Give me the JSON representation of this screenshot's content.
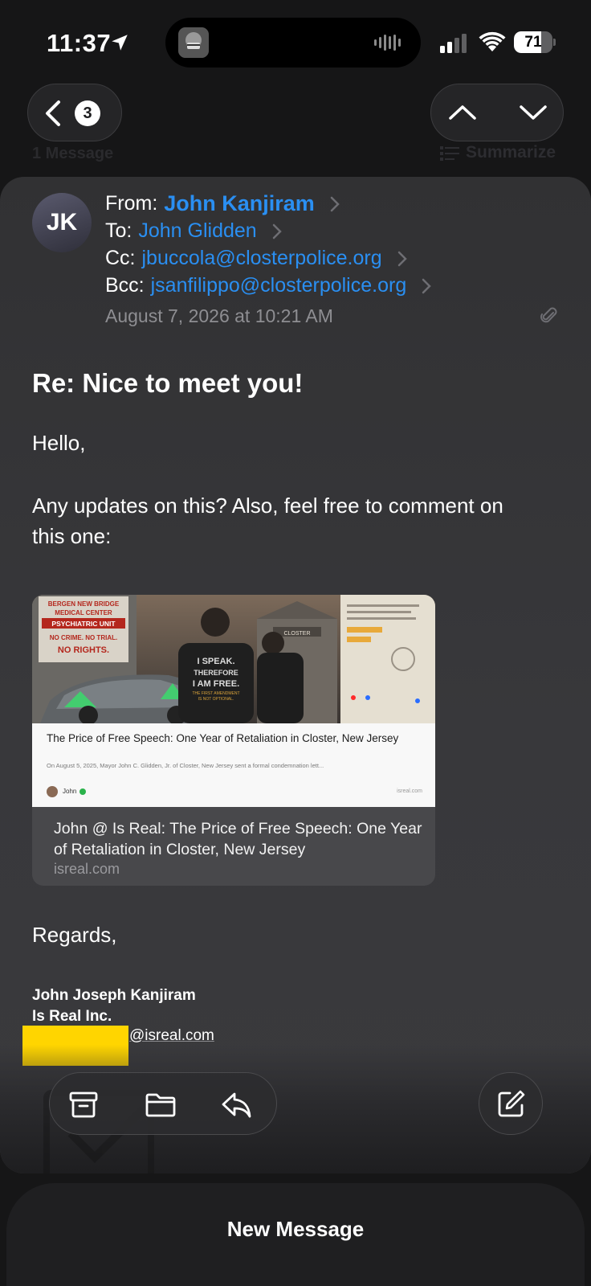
{
  "status_bar": {
    "time": "11:37",
    "battery_percent": "71",
    "battery_level": 0.71,
    "icons": [
      "location-arrow-icon",
      "signal-icon",
      "wifi-icon",
      "battery-icon"
    ]
  },
  "nav": {
    "back_count": "3",
    "messages_count": "1 Message",
    "summarize_label": "Summarize"
  },
  "email": {
    "avatar_initials": "JK",
    "from_label": "From:",
    "from": "John Kanjiram",
    "to_label": "To:",
    "to": "John Glidden",
    "cc_label": "Cc:",
    "cc": "jbuccola@closterpolice.org",
    "bcc_label": "Bcc:",
    "bcc": "jsanfilippo@closterpolice.org",
    "date": "August 7, 2026 at 10:21 AM",
    "subject": "Re: Nice to meet you!",
    "greeting": "Hello,",
    "body_line1": "Any updates on this? Also, feel free to comment on",
    "body_line2": "this one:",
    "closing": "Regards,",
    "signature_name": "John Joseph Kanjiram",
    "signature_company": "Is Real Inc.",
    "signature_email": "@isreal.com"
  },
  "link_preview": {
    "article_title": "The Price of Free Speech: One Year of Retaliation in Closter,  New Jersey",
    "article_desc": "On August 5, 2025, Mayor John C. Glidden, Jr. of Closter, New Jersey sent a formal condemnation lett...",
    "article_author": "John",
    "article_domain": "isreal.com",
    "caption": "John @ Is Real: The Price of Free Speech: One Year of Retaliation in Closter, New Jersey",
    "domain": "isreal.com",
    "image_texts": {
      "sign_line1": "BERGEN NEW BRIDGE",
      "sign_line2": "MEDICAL CENTER",
      "sign_line3": "PSYCHIATRIC UNIT",
      "sign_line4": "NO CRIME. NO TRIAL.",
      "sign_line5": "NO RIGHTS.",
      "shirt_line1": "I SPEAK.",
      "shirt_line2": "THEREFORE",
      "shirt_line3": "I AM FREE.",
      "shirt_line4": "THE FIRST AMENDMENT",
      "shirt_line5": "IS NOT OPTIONAL.",
      "building_label": "CLOSTER"
    }
  },
  "toolbar": {
    "icons": [
      "archive-icon",
      "folder-icon",
      "reply-icon",
      "compose-icon"
    ]
  },
  "sheet": {
    "title": "New Message"
  }
}
